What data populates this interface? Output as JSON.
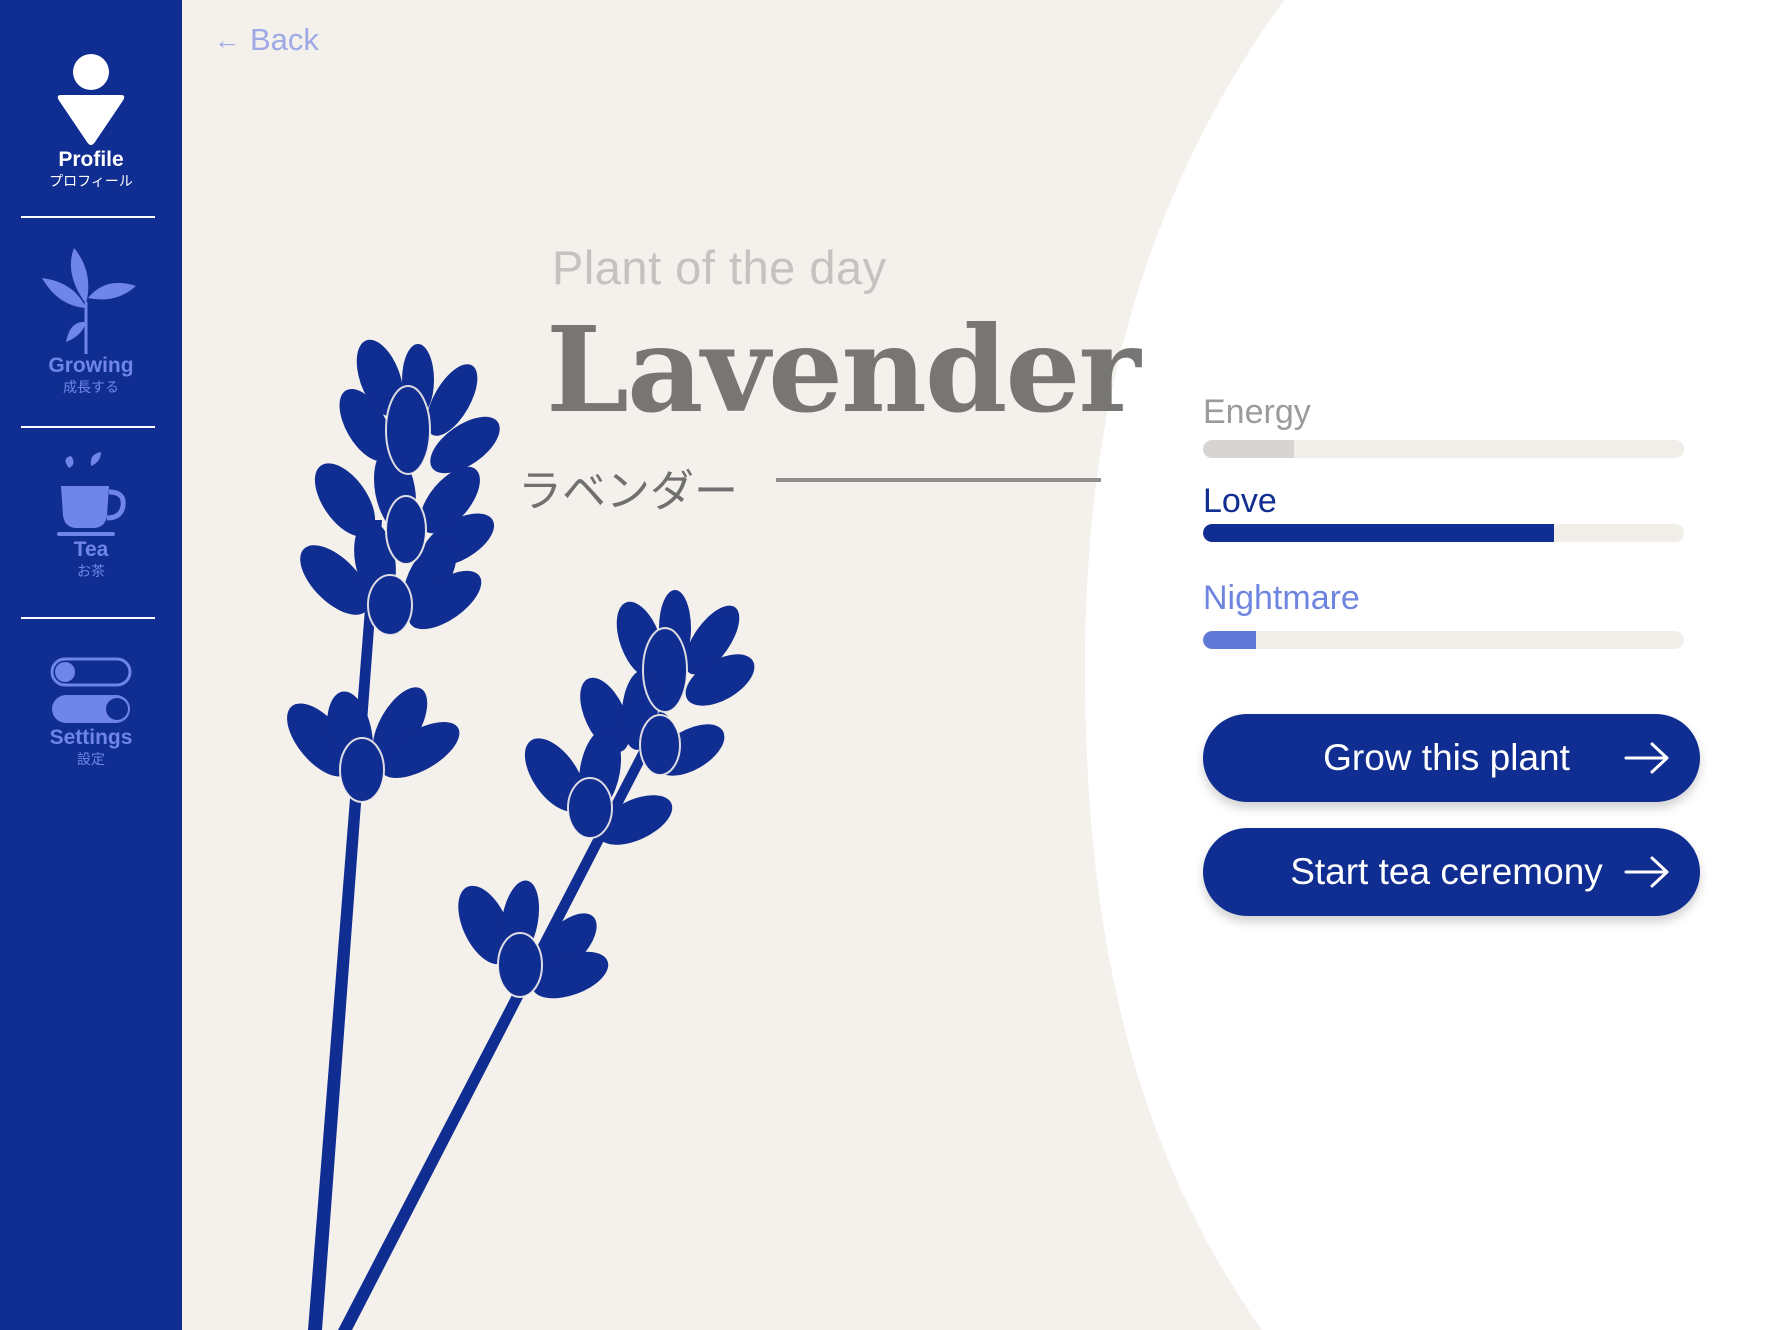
{
  "sidebar": {
    "items": [
      {
        "label": "Profile",
        "sub": "プロフィール",
        "icon": "profile-icon",
        "active": true
      },
      {
        "label": "Growing",
        "sub": "成長する",
        "icon": "sprout-icon",
        "active": false
      },
      {
        "label": "Tea",
        "sub": "お茶",
        "icon": "teacup-icon",
        "active": false
      },
      {
        "label": "Settings",
        "sub": "設定",
        "icon": "toggles-icon",
        "active": false
      }
    ]
  },
  "back": {
    "label": "Back",
    "icon": "back-arrow-icon"
  },
  "plant": {
    "subtitle": "Plant of the day",
    "name": "Lavender",
    "name_jp": "ラベンダー"
  },
  "stats": [
    {
      "label": "Energy",
      "value": 0.19,
      "color": "#d6d5d3",
      "label_color": "#9b9b9b"
    },
    {
      "label": "Love",
      "value": 0.73,
      "color": "#102d91",
      "label_color": "#102d91"
    },
    {
      "label": "Nightmare",
      "value": 0.11,
      "color": "#6079d8",
      "label_color": "#6f85e0"
    }
  ],
  "actions": {
    "grow": "Grow this plant",
    "tea": "Start tea ceremony"
  },
  "colors": {
    "brand": "#102d91",
    "background": "#f4f0eb",
    "panel": "#ffffff"
  }
}
